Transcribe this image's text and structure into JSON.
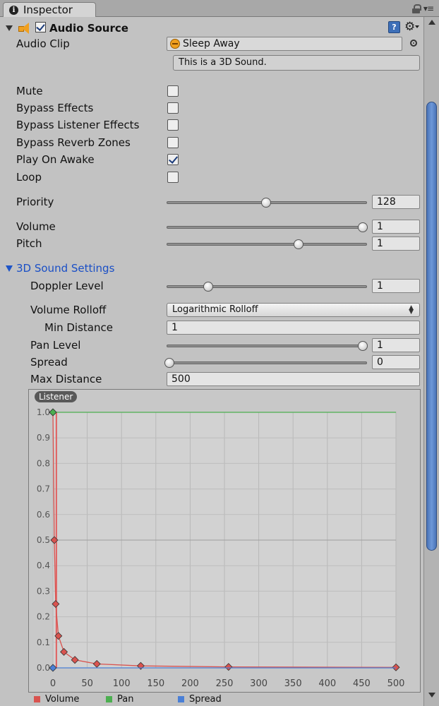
{
  "window": {
    "tab_title": "Inspector"
  },
  "component": {
    "title": "Audio Source"
  },
  "audio_clip": {
    "label": "Audio Clip",
    "value": "Sleep Away",
    "note": "This is a 3D Sound."
  },
  "toggles": [
    {
      "label": "Mute",
      "checked": false
    },
    {
      "label": "Bypass Effects",
      "checked": false
    },
    {
      "label": "Bypass Listener Effects",
      "checked": false
    },
    {
      "label": "Bypass Reverb Zones",
      "checked": false
    },
    {
      "label": "Play On Awake",
      "checked": true
    },
    {
      "label": "Loop",
      "checked": false
    }
  ],
  "priority": {
    "label": "Priority",
    "value": "128",
    "fraction": 0.5
  },
  "volume": {
    "label": "Volume",
    "value": "1",
    "fraction": 1.0
  },
  "pitch": {
    "label": "Pitch",
    "value": "1",
    "fraction": 0.667
  },
  "sound3d": {
    "section_label": "3D Sound Settings",
    "doppler": {
      "label": "Doppler Level",
      "value": "1",
      "fraction": 0.2
    },
    "rolloff": {
      "label": "Volume Rolloff",
      "value": "Logarithmic Rolloff"
    },
    "min_distance": {
      "label": "Min Distance",
      "value": "1"
    },
    "pan_level": {
      "label": "Pan Level",
      "value": "1",
      "fraction": 1.0
    },
    "spread": {
      "label": "Spread",
      "value": "0",
      "fraction": 0.0
    },
    "max_distance": {
      "label": "Max Distance",
      "value": "500"
    }
  },
  "graph": {
    "badge": "Listener"
  },
  "chart_data": {
    "type": "line",
    "title": "",
    "xlabel": "",
    "ylabel": "",
    "xlim": [
      0,
      500
    ],
    "ylim": [
      0,
      1
    ],
    "x_ticks": [
      "0",
      "50",
      "100",
      "150",
      "200",
      "250",
      "300",
      "350",
      "400",
      "450",
      "500"
    ],
    "y_ticks": [
      "0.0",
      "0.1",
      "0.2",
      "0.3",
      "0.4",
      "0.5",
      "0.6",
      "0.7",
      "0.8",
      "0.9",
      "1.0"
    ],
    "grid": true,
    "listener_distance": 5,
    "series": [
      {
        "name": "Volume",
        "color": "#d9534f",
        "x": [
          0,
          2,
          4,
          8,
          16,
          32,
          64,
          128,
          256,
          500
        ],
        "y": [
          1.0,
          0.5,
          0.25,
          0.125,
          0.0625,
          0.03125,
          0.0156,
          0.0078,
          0.0039,
          0.002
        ]
      },
      {
        "name": "Pan",
        "color": "#4caf50",
        "x": [
          0,
          500
        ],
        "y": [
          1.0,
          1.0
        ]
      },
      {
        "name": "Spread",
        "color": "#4a7fd6",
        "x": [
          0,
          500
        ],
        "y": [
          0.0,
          0.0
        ]
      }
    ]
  }
}
